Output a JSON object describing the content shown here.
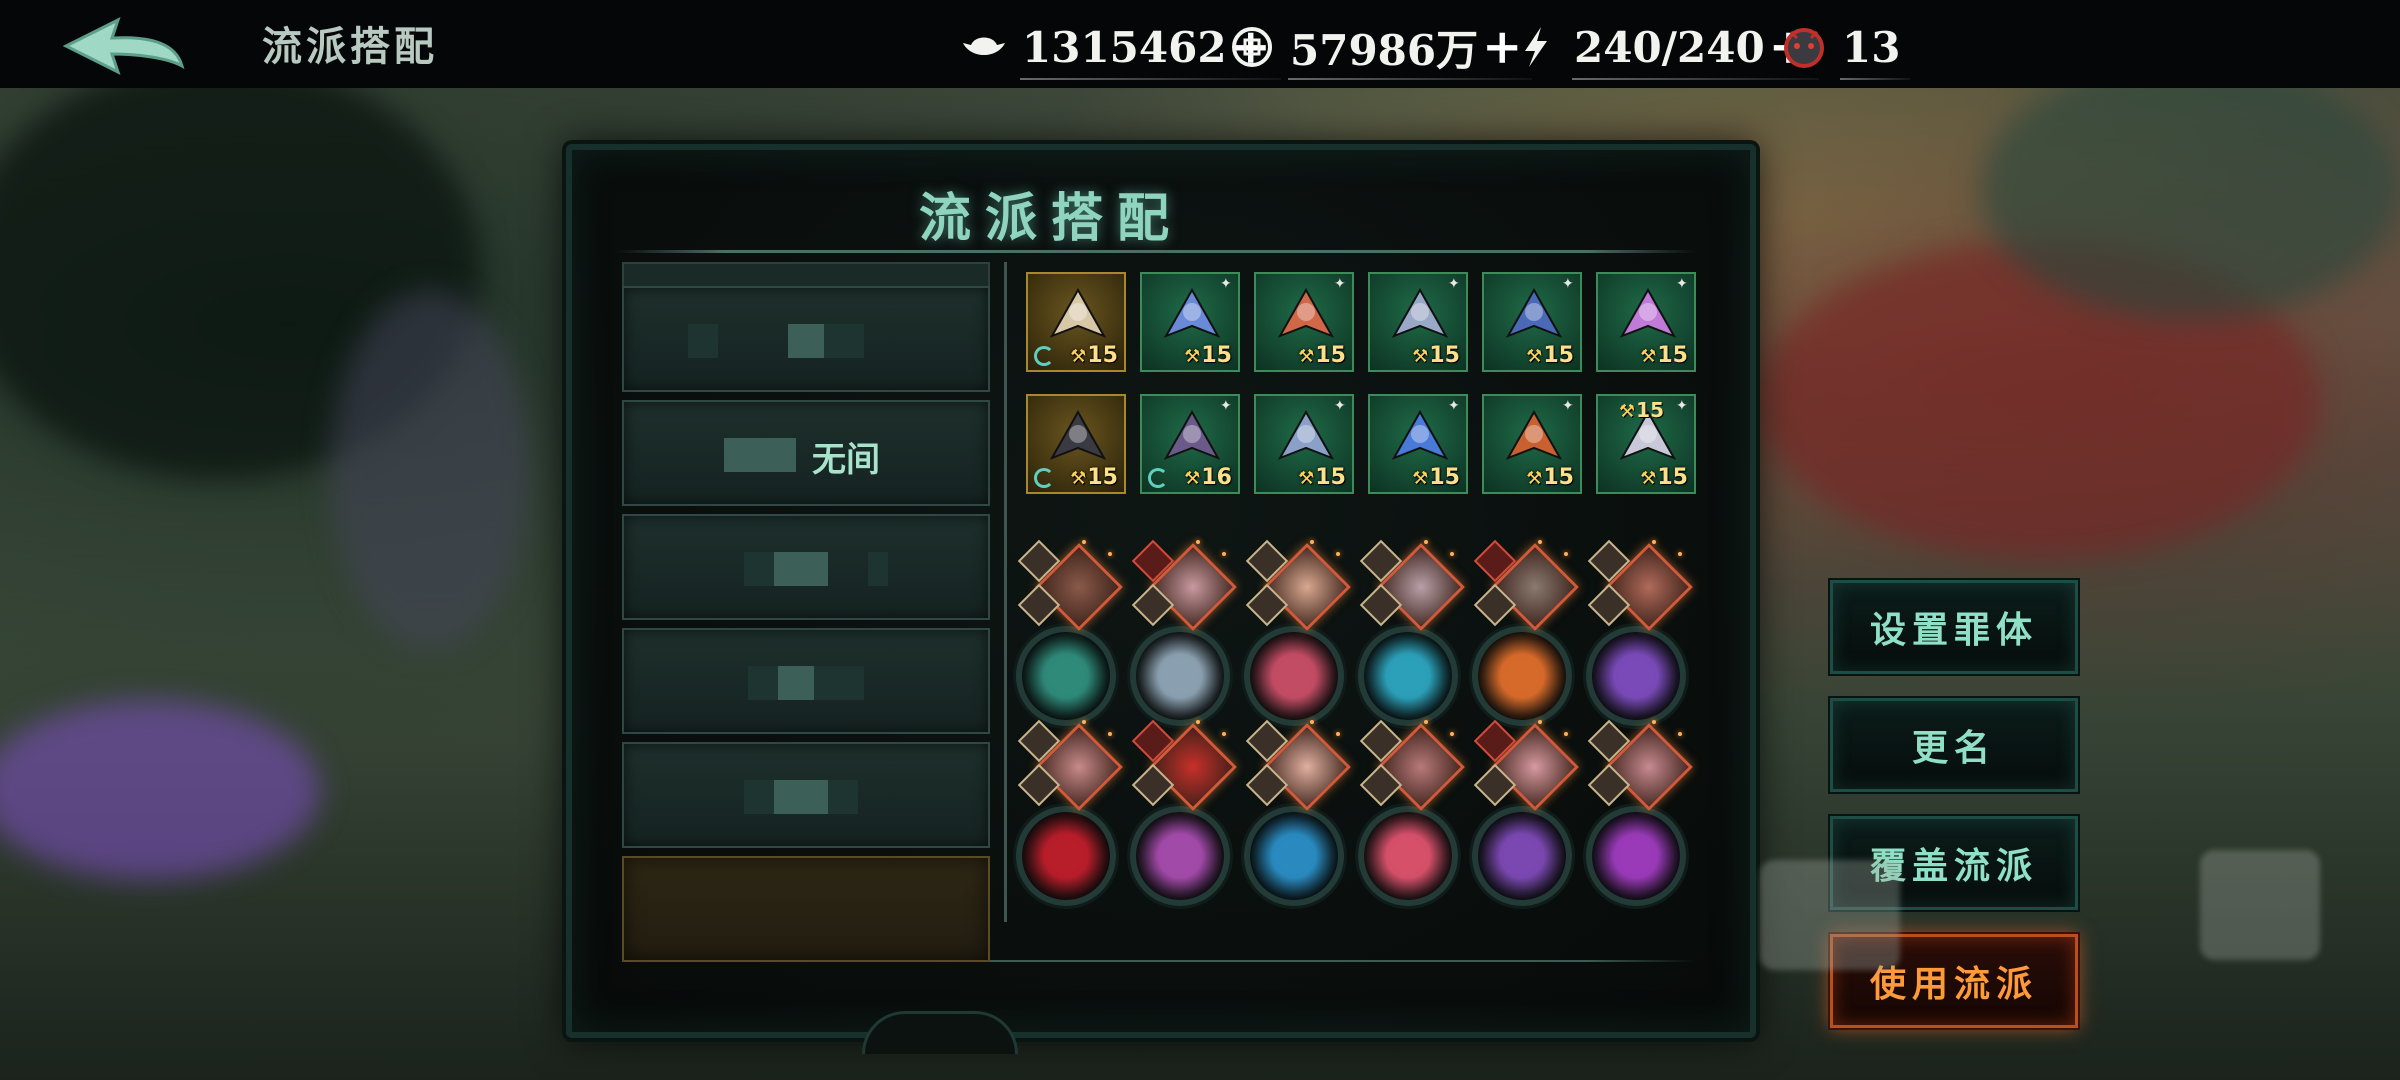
{
  "header": {
    "title": "流派搭配",
    "back_icon": "back-arrow-icon"
  },
  "resources": [
    {
      "icon": "silver-ingot-icon",
      "value": "1315462",
      "plus": "+"
    },
    {
      "icon": "coin-icon",
      "value": "57986万",
      "plus": "+"
    },
    {
      "icon": "lightning-icon",
      "value": "240/240",
      "plus": "+"
    },
    {
      "icon": "demon-mask-icon",
      "value": "13"
    }
  ],
  "panel": {
    "title": "流派搭配",
    "loadouts": [
      {
        "name": ""
      },
      {
        "name": "无间",
        "selected": true
      },
      {
        "name": ""
      },
      {
        "name": ""
      },
      {
        "name": ""
      },
      {
        "name": "",
        "empty": true
      }
    ],
    "equipment": [
      {
        "item": "war-fan-icon",
        "level": "15",
        "frame": "gold",
        "cycle": true
      },
      {
        "item": "gauntlet-icon",
        "level": "15"
      },
      {
        "item": "chest-armor-icon",
        "level": "15"
      },
      {
        "item": "shoulder-armor-icon",
        "level": "15"
      },
      {
        "item": "helmet-icon",
        "level": "15"
      },
      {
        "item": "bangle-icon",
        "level": "15"
      },
      {
        "item": "butterfly-armor-icon",
        "level": "15",
        "frame": "gold",
        "cycle": true
      },
      {
        "item": "dark-robe-icon",
        "level": "16",
        "cycle": true
      },
      {
        "item": "bracer-icon",
        "level": "15"
      },
      {
        "item": "belt-icon",
        "level": "15"
      },
      {
        "item": "pauldron-icon",
        "level": "15"
      },
      {
        "item": "blades-icon",
        "level": "15",
        "level_top": "15"
      }
    ],
    "skills": [
      {
        "portrait": "portrait-icon",
        "emblem": "leaf-emblem-icon",
        "color": "#2f8a7a"
      },
      {
        "portrait": "portrait-icon",
        "emblem": "scroll-emblem-icon",
        "color": "#8aa0b0"
      },
      {
        "portrait": "portrait-icon",
        "emblem": "petal-emblem-icon",
        "color": "#c24c64"
      },
      {
        "portrait": "portrait-icon",
        "emblem": "claw-emblem-icon",
        "color": "#2ba0b8"
      },
      {
        "portrait": "portrait-icon",
        "emblem": "vortex-emblem-icon",
        "color": "#d66a2a"
      },
      {
        "portrait": "portrait-icon",
        "emblem": "wing-emblem-icon",
        "color": "#7a4ab8"
      },
      {
        "portrait": "portrait-icon",
        "emblem": "spiral-emblem-icon",
        "color": "#b81e2a"
      },
      {
        "portrait": "portrait-icon",
        "emblem": "crescent-emblem-icon",
        "color": "#a24aa8"
      },
      {
        "portrait": "portrait-icon",
        "emblem": "stripe-emblem-icon",
        "color": "#2a8ac0"
      },
      {
        "portrait": "portrait-icon",
        "emblem": "spider-emblem-icon",
        "color": "#d6506a"
      },
      {
        "portrait": "portrait-icon",
        "emblem": "moon-emblem-icon",
        "color": "#7a48b0"
      },
      {
        "portrait": "portrait-icon",
        "emblem": "swirl-emblem-icon",
        "color": "#9a3ab8"
      }
    ]
  },
  "actions": {
    "set_body": "设置罪体",
    "rename": "更名",
    "overwrite": "覆盖流派",
    "use": "使用流派"
  },
  "colors": {
    "accent": "#8fe0c4",
    "primary_button": "#ff9a3a",
    "equip_green": "#1f6a48",
    "equip_gold": "#6a5520"
  }
}
